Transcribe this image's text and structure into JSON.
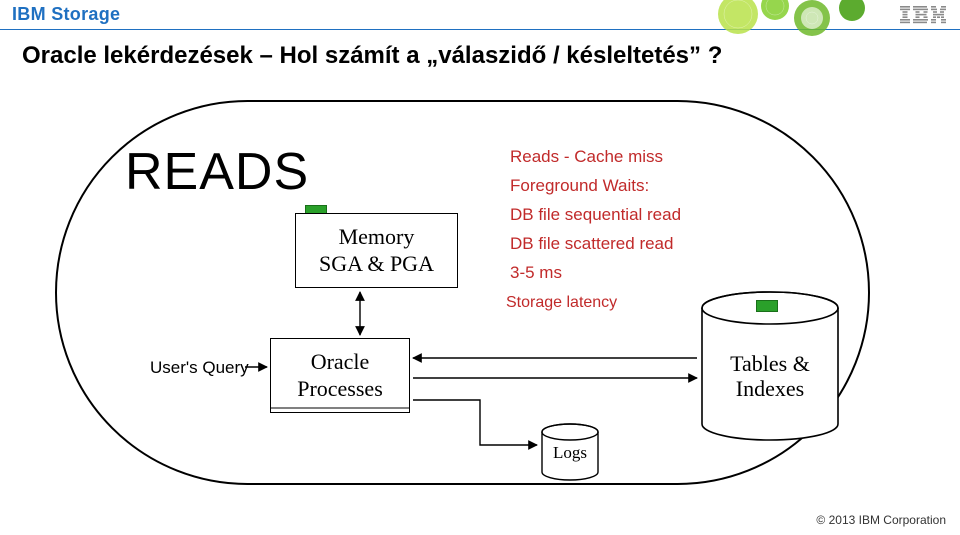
{
  "header": {
    "brand": "IBM Storage"
  },
  "title": "Oracle lekérdezések – Hol számít a „válaszidő / késleltetés” ?",
  "reads_heading": "READS",
  "memory": {
    "line1": "Memory",
    "line2": "SGA & PGA"
  },
  "user_query": "User's Query",
  "oracle": {
    "line1": "Oracle",
    "line2": "Processes"
  },
  "reads_info": {
    "l1": "Reads - Cache miss",
    "l2": "Foreground Waits:",
    "l3": "DB file sequential read",
    "l4": "DB file scattered read",
    "l5": "3-5 ms",
    "storage_latency": "Storage latency"
  },
  "tables": {
    "line1": "Tables &",
    "line2": "Indexes"
  },
  "logs": "Logs",
  "footer": "© 2013 IBM Corporation"
}
